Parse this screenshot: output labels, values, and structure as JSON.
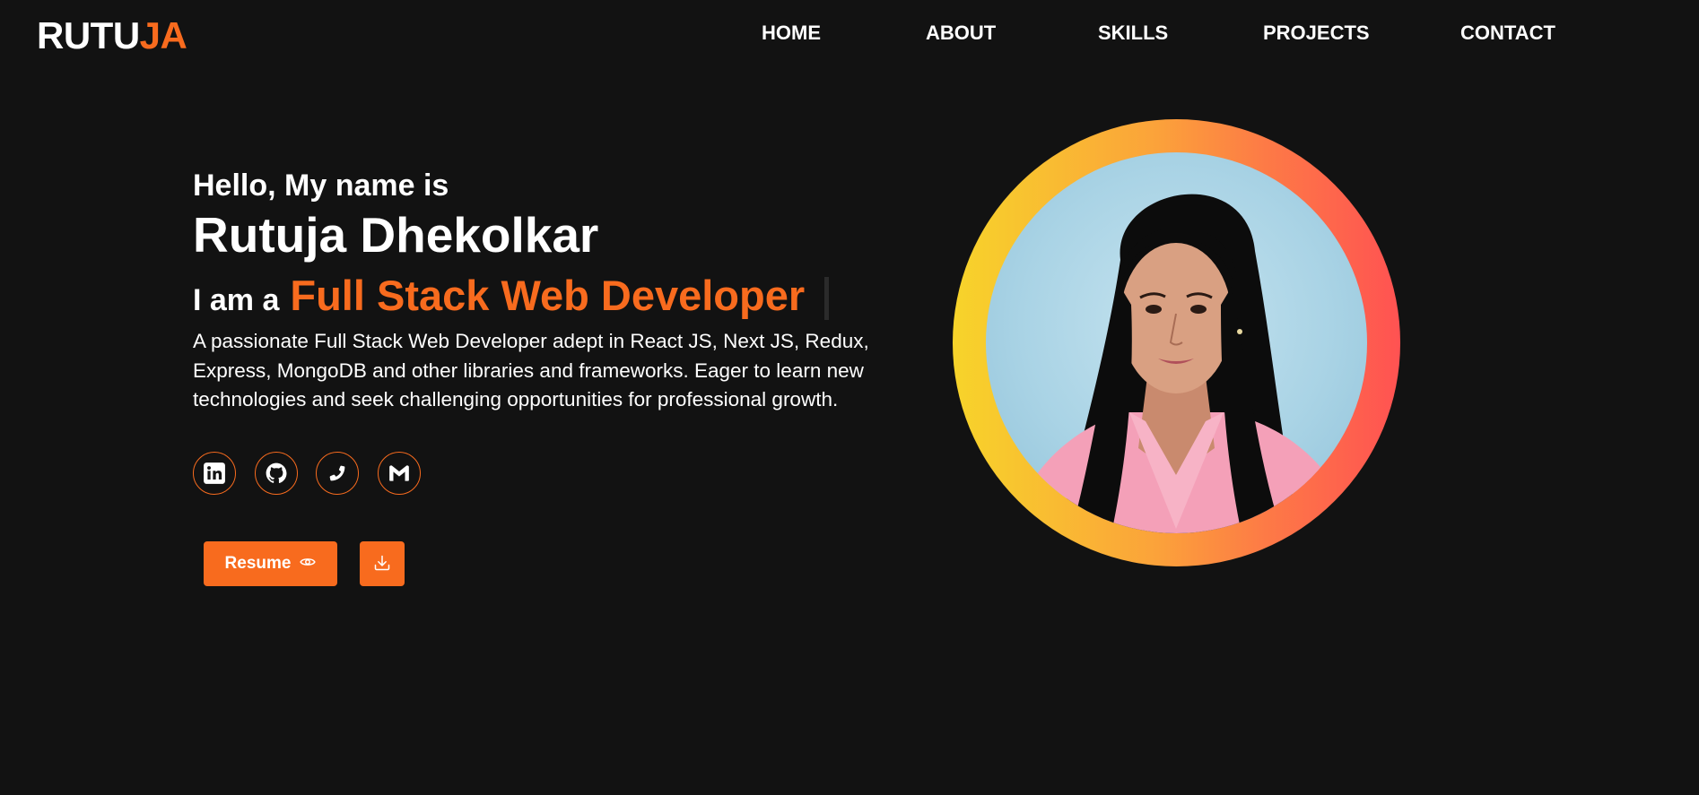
{
  "navbar": {
    "logo_part1": "RUTU",
    "logo_part2": "JA",
    "links": [
      {
        "label": "HOME"
      },
      {
        "label": "ABOUT"
      },
      {
        "label": "SKILLS"
      },
      {
        "label": "PROJECTS"
      },
      {
        "label": "CONTACT"
      }
    ]
  },
  "hero": {
    "greeting": "Hello, My name is",
    "name": "Rutuja Dhekolkar",
    "role_prefix": "I am a",
    "role": "Full Stack Web Developer",
    "description": "A passionate Full Stack Web Developer adept in React JS, Next JS, Redux, Express, MongoDB and other libraries and frameworks. Eager to learn new technologies and seek challenging opportunities for professional growth."
  },
  "socials": [
    {
      "icon": "linkedin-icon"
    },
    {
      "icon": "github-icon"
    },
    {
      "icon": "phone-icon"
    },
    {
      "icon": "gmail-icon"
    }
  ],
  "buttons": {
    "resume_label": "Resume",
    "resume_icon": "eye-icon",
    "download_icon": "download-icon"
  },
  "colors": {
    "background": "#121212",
    "accent": "#f86b1e",
    "ring_gradient": [
      "#f7d42a",
      "#fba33a",
      "#fd7a46",
      "#ff5252"
    ]
  }
}
